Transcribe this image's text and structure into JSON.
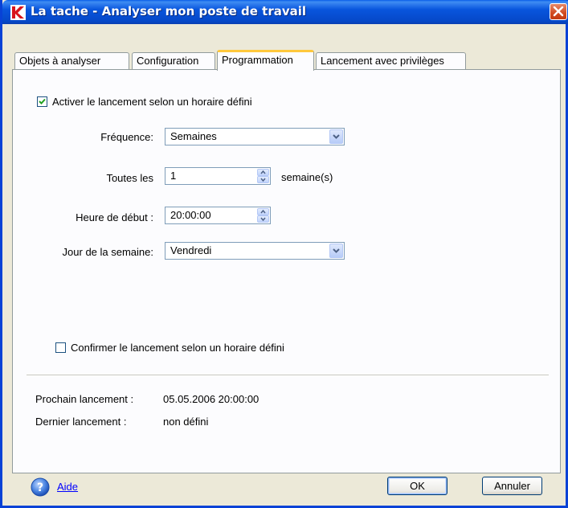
{
  "window": {
    "title": "La tache - Analyser mon poste de travail"
  },
  "tabs": [
    {
      "label": "Objets à analyser",
      "active": false
    },
    {
      "label": "Configuration",
      "active": false
    },
    {
      "label": "Programmation",
      "active": true
    },
    {
      "label": "Lancement avec privilèges",
      "active": false
    }
  ],
  "schedule": {
    "enable_label": "Activer le lancement selon un horaire défini",
    "enable_checked": true,
    "frequency_label": "Fréquence:",
    "frequency_value": "Semaines",
    "every_label": "Toutes les",
    "every_value": "1",
    "every_unit": "semaine(s)",
    "start_time_label": "Heure de début :",
    "start_time_value": "20:00:00",
    "weekday_label": "Jour de la semaine:",
    "weekday_value": "Vendredi",
    "confirm_label": "Confirmer le lancement selon un horaire défini",
    "confirm_checked": false
  },
  "status": {
    "next_label": "Prochain lancement :",
    "next_value": "05.05.2006 20:00:00",
    "last_label": "Dernier lancement :",
    "last_value": "non défini"
  },
  "footer": {
    "help_label": "Aide",
    "ok_label": "OK",
    "cancel_label": "Annuler"
  },
  "icons": {
    "app": "kaspersky-k-icon",
    "close": "close-icon",
    "help": "help-question-icon",
    "check": "checkmark-icon",
    "dropdown": "chevron-down-icon",
    "spin": "spinner-arrows-icon"
  },
  "colors": {
    "titlebar": "#0855dd",
    "close_button": "#d14a20",
    "active_tab_accent": "#ffc83c",
    "link": "#0000ff",
    "check": "#21a121"
  }
}
